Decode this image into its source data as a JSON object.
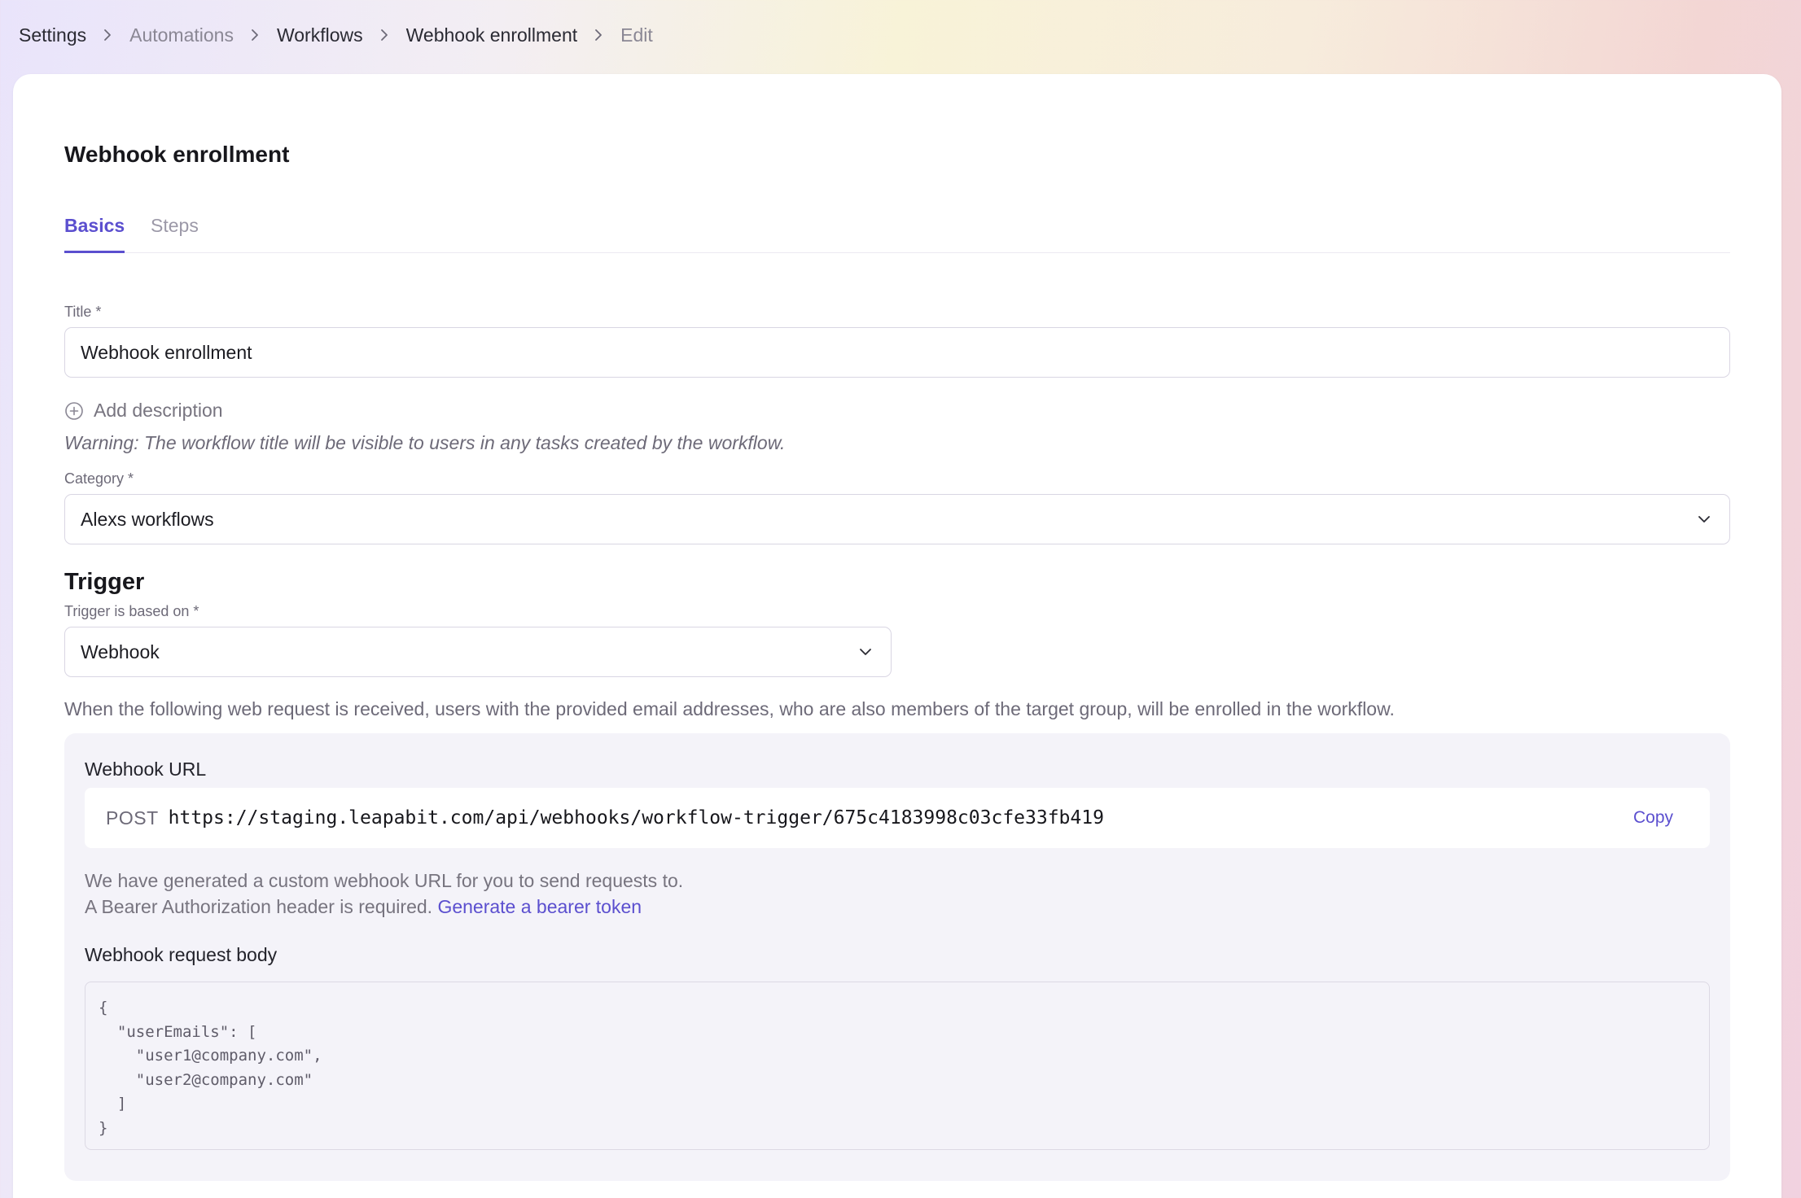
{
  "breadcrumb": [
    {
      "label": "Settings",
      "muted": false
    },
    {
      "label": "Automations",
      "muted": true
    },
    {
      "label": "Workflows",
      "muted": false
    },
    {
      "label": "Webhook enrollment",
      "muted": false
    },
    {
      "label": "Edit",
      "muted": true
    }
  ],
  "page": {
    "title": "Webhook enrollment"
  },
  "tabs": [
    {
      "label": "Basics",
      "active": true
    },
    {
      "label": "Steps",
      "active": false
    }
  ],
  "form": {
    "title_label": "Title *",
    "title_value": "Webhook enrollment",
    "add_description": "Add description",
    "warning": "Warning: The workflow title will be visible to users in any tasks created by the workflow.",
    "category_label": "Category *",
    "category_value": "Alexs workflows"
  },
  "trigger": {
    "heading": "Trigger",
    "based_on_label": "Trigger is based on *",
    "based_on_value": "Webhook",
    "description": "When the following web request is received, users with the provided email addresses, who are also members of the target group, will be enrolled in the workflow."
  },
  "webhook": {
    "url_heading": "Webhook URL",
    "method": "POST",
    "url": "https://staging.leapabit.com/api/webhooks/workflow-trigger/675c4183998c03cfe33fb419",
    "copy_label": "Copy",
    "help_line1": "We have generated a custom webhook URL for you to send requests to.",
    "help_line2": "A Bearer Authorization header is required.",
    "generate_token_link": "Generate a bearer token",
    "body_heading": "Webhook request body",
    "body_code": "{\n  \"userEmails\": [\n    \"user1@company.com\",\n    \"user2@company.com\"\n  ]\n}"
  },
  "icons": {
    "breadcrumb_separator": "chevron-right-icon",
    "add_description": "plus-circle-icon",
    "select_arrow": "chevron-down-icon"
  },
  "colors": {
    "accent": "#5b4fcf",
    "muted_text": "#6d6a78",
    "panel_bg": "#f4f3f9"
  }
}
